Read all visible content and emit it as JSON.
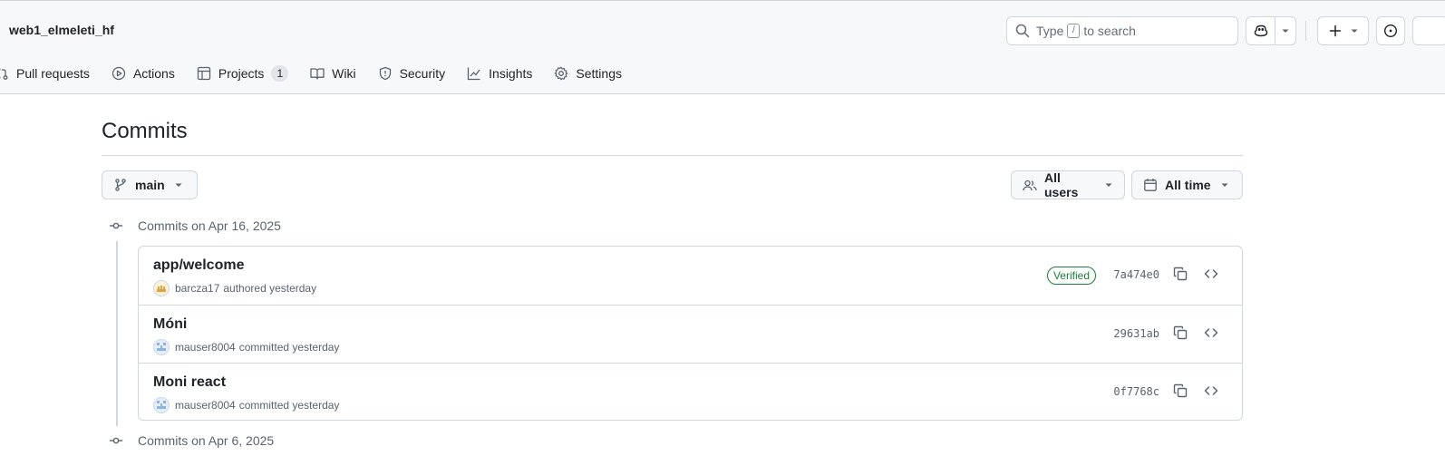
{
  "header": {
    "repo_name": "web1_elmeleti_hf",
    "search": {
      "prefix": "Type",
      "key": "/",
      "suffix": "to search"
    }
  },
  "nav": {
    "items": [
      {
        "label": "Pull requests",
        "icon": "pull-request-icon"
      },
      {
        "label": "Actions",
        "icon": "play-icon"
      },
      {
        "label": "Projects",
        "icon": "table-icon",
        "count": "1"
      },
      {
        "label": "Wiki",
        "icon": "book-icon"
      },
      {
        "label": "Security",
        "icon": "shield-icon"
      },
      {
        "label": "Insights",
        "icon": "graph-icon"
      },
      {
        "label": "Settings",
        "icon": "gear-icon"
      }
    ]
  },
  "page": {
    "title": "Commits",
    "branch": "main",
    "users_filter": "All users",
    "time_filter": "All time"
  },
  "groups": [
    {
      "label": "Commits on Apr 16, 2025"
    },
    {
      "label": "Commits on Apr 6, 2025"
    }
  ],
  "commits": [
    {
      "message": "app/welcome",
      "author": "barcza17",
      "action": "authored yesterday",
      "verified": "Verified",
      "sha": "7a474e0"
    },
    {
      "message": "Móni",
      "author": "mauser8004",
      "action": "committed yesterday",
      "sha": "29631ab"
    },
    {
      "message": "Moni react",
      "author": "mauser8004",
      "action": "committed yesterday",
      "sha": "0f7768c"
    }
  ],
  "colors": {
    "header_bg": "#f6f8fa",
    "border": "#d0d7de",
    "verified_green": "#1a7f37",
    "muted_text": "#59636e"
  }
}
